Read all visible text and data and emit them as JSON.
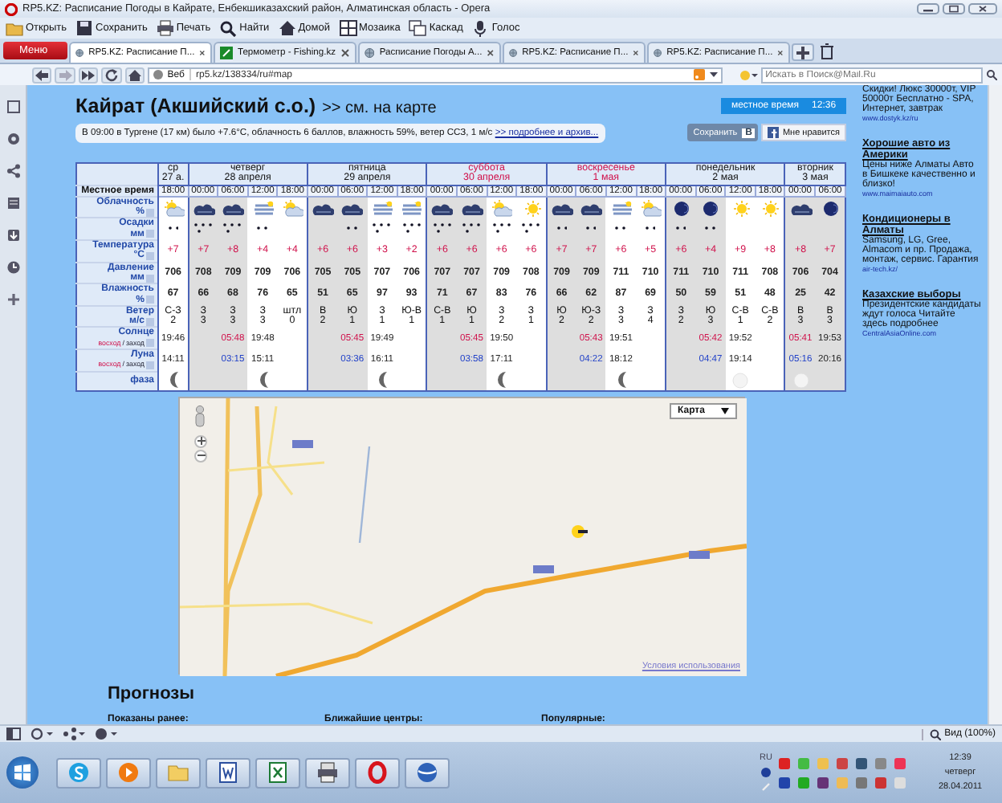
{
  "window": {
    "title": "RP5.KZ: Расписание Погоды в Кайрате, Енбекшиказахский район, Алматинская область - Opera"
  },
  "toolbar": [
    {
      "label": "Открыть"
    },
    {
      "label": "Сохранить"
    },
    {
      "label": "Печать"
    },
    {
      "label": "Найти"
    },
    {
      "label": "Домой"
    },
    {
      "label": "Мозаика"
    },
    {
      "label": "Каскад"
    },
    {
      "label": "Голос"
    }
  ],
  "menu_button": "Меню",
  "tabs": [
    {
      "label": "RP5.KZ: Расписание П...",
      "selected": true
    },
    {
      "label": "Термометр - Fishing.kz",
      "selected": false
    },
    {
      "label": "Расписание Погоды А...",
      "selected": false
    },
    {
      "label": "RP5.KZ: Расписание П...",
      "selected": false
    },
    {
      "label": "RP5.KZ: Расписание П...",
      "selected": false
    }
  ],
  "address_bar": {
    "search_engine": "Веб",
    "url": "rp5.kz/138334/ru#map",
    "search_placeholder": "Искать в Поиск@Mail.Ru"
  },
  "page": {
    "title": "Кайрат (Акшийский с.о.)",
    "map_link": ">> см. на карте",
    "local_time_label": "местное время",
    "local_time": "12:36",
    "observation": "В 09:00 в Тургене (17 км) было +7.6°C, облачность 6 баллов, влажность 59%, ветер ССЗ, 1 м/с",
    "observation_link": ">> подробнее и архив...",
    "save_button": "Сохранить",
    "save_badge": "В",
    "like_button": "Мне нравится"
  },
  "forecast": {
    "time_label": "Местное время",
    "row_labels": [
      {
        "name": "Облачность",
        "unit": "%"
      },
      {
        "name": "Осадки",
        "unit": "мм"
      },
      {
        "name": "Температура",
        "unit": "°C"
      },
      {
        "name": "Давление",
        "unit": "мм"
      },
      {
        "name": "Влажность",
        "unit": "%"
      },
      {
        "name": "Ветер",
        "unit": "м/с"
      }
    ],
    "sun_label": {
      "name": "Солнце",
      "rise": "восход",
      "sep": "/",
      "set": "заход"
    },
    "moon_label": {
      "name": "Луна",
      "rise": "восход",
      "sep": "/",
      "set": "заход",
      "phase": "фаза"
    },
    "days": [
      {
        "weekday": "ср",
        "date": "27 а.",
        "weekend": false,
        "sun": {
          "set": "19:46"
        },
        "moon": {
          "set": "14:11"
        },
        "phase": {
          "kind": "crescent"
        },
        "columns": [
          {
            "time": "18:00",
            "night": false,
            "sky": {
              "kind": "sun-cloud"
            },
            "precip": {
              "kind": "light"
            },
            "temp": "+7",
            "pressure": "706",
            "humidity": "67",
            "wind_dir": "С-З",
            "wind_speed": "2"
          }
        ]
      },
      {
        "weekday": "четверг",
        "date": "28 апреля",
        "weekend": false,
        "sun": {
          "rise": "05:48",
          "set": "19:48"
        },
        "moon": {
          "rise": "03:15",
          "set": "15:11"
        },
        "phase": {
          "kind": "crescent"
        },
        "columns": [
          {
            "time": "00:00",
            "night": true,
            "sky": {
              "kind": "dark"
            },
            "precip": {
              "kind": "medium"
            },
            "temp": "+7",
            "pressure": "708",
            "humidity": "66",
            "wind_dir": "З",
            "wind_speed": "3"
          },
          {
            "time": "06:00",
            "night": true,
            "sky": {
              "kind": "dark"
            },
            "precip": {
              "kind": "medium"
            },
            "temp": "+8",
            "pressure": "709",
            "humidity": "68",
            "wind_dir": "З",
            "wind_speed": "3"
          },
          {
            "time": "12:00",
            "night": false,
            "sky": {
              "kind": "stratus"
            },
            "precip": {
              "kind": "light"
            },
            "temp": "+4",
            "pressure": "709",
            "humidity": "76",
            "wind_dir": "З",
            "wind_speed": "3"
          },
          {
            "time": "18:00",
            "night": false,
            "sky": {
              "kind": "sun-cloud"
            },
            "precip": {
              "kind": "none"
            },
            "temp": "+4",
            "pressure": "706",
            "humidity": "65",
            "wind_dir": "штл",
            "wind_speed": "0"
          }
        ]
      },
      {
        "weekday": "пятница",
        "date": "29 апреля",
        "weekend": false,
        "sun": {
          "rise": "05:45",
          "set": "19:49"
        },
        "moon": {
          "rise": "03:36",
          "set": "16:11"
        },
        "phase": {
          "kind": "crescent"
        },
        "columns": [
          {
            "time": "00:00",
            "night": true,
            "sky": {
              "kind": "dark"
            },
            "precip": {
              "kind": "none"
            },
            "temp": "+6",
            "pressure": "705",
            "humidity": "51",
            "wind_dir": "В",
            "wind_speed": "2"
          },
          {
            "time": "06:00",
            "night": true,
            "sky": {
              "kind": "dark"
            },
            "precip": {
              "kind": "light"
            },
            "temp": "+6",
            "pressure": "705",
            "humidity": "65",
            "wind_dir": "Ю",
            "wind_speed": "1"
          },
          {
            "time": "12:00",
            "night": false,
            "sky": {
              "kind": "stratus"
            },
            "precip": {
              "kind": "medium"
            },
            "temp": "+3",
            "pressure": "707",
            "humidity": "97",
            "wind_dir": "З",
            "wind_speed": "1"
          },
          {
            "time": "18:00",
            "night": false,
            "sky": {
              "kind": "stratus"
            },
            "precip": {
              "kind": "medium"
            },
            "temp": "+2",
            "pressure": "706",
            "humidity": "93",
            "wind_dir": "Ю-В",
            "wind_speed": "1"
          }
        ]
      },
      {
        "weekday": "суббота",
        "date": "30 апреля",
        "weekend": true,
        "sun": {
          "rise": "05:45",
          "set": "19:50"
        },
        "moon": {
          "rise": "03:58",
          "set": "17:11"
        },
        "phase": {
          "kind": "crescent"
        },
        "columns": [
          {
            "time": "00:00",
            "night": true,
            "sky": {
              "kind": "dark"
            },
            "precip": {
              "kind": "medium"
            },
            "temp": "+6",
            "pressure": "707",
            "humidity": "71",
            "wind_dir": "С-В",
            "wind_speed": "1"
          },
          {
            "time": "06:00",
            "night": true,
            "sky": {
              "kind": "dark"
            },
            "precip": {
              "kind": "medium"
            },
            "temp": "+6",
            "pressure": "707",
            "humidity": "67",
            "wind_dir": "Ю",
            "wind_speed": "1"
          },
          {
            "time": "12:00",
            "night": false,
            "sky": {
              "kind": "sun-cloud"
            },
            "precip": {
              "kind": "medium"
            },
            "temp": "+6",
            "pressure": "709",
            "humidity": "83",
            "wind_dir": "З",
            "wind_speed": "2"
          },
          {
            "time": "18:00",
            "night": false,
            "sky": {
              "kind": "sun"
            },
            "precip": {
              "kind": "medium"
            },
            "temp": "+6",
            "pressure": "708",
            "humidity": "76",
            "wind_dir": "З",
            "wind_speed": "1"
          }
        ]
      },
      {
        "weekday": "воскресенье",
        "date": "1 мая",
        "weekend": true,
        "sun": {
          "rise": "05:43",
          "set": "19:51"
        },
        "moon": {
          "rise": "04:22",
          "set": "18:12"
        },
        "phase": {
          "kind": "crescent"
        },
        "columns": [
          {
            "time": "00:00",
            "night": true,
            "sky": {
              "kind": "dark"
            },
            "precip": {
              "kind": "light"
            },
            "temp": "+7",
            "pressure": "709",
            "humidity": "66",
            "wind_dir": "Ю",
            "wind_speed": "2"
          },
          {
            "time": "06:00",
            "night": true,
            "sky": {
              "kind": "dark"
            },
            "precip": {
              "kind": "light"
            },
            "temp": "+7",
            "pressure": "709",
            "humidity": "62",
            "wind_dir": "Ю-З",
            "wind_speed": "2"
          },
          {
            "time": "12:00",
            "night": false,
            "sky": {
              "kind": "stratus"
            },
            "precip": {
              "kind": "light"
            },
            "temp": "+6",
            "pressure": "711",
            "humidity": "87",
            "wind_dir": "З",
            "wind_speed": "3"
          },
          {
            "time": "18:00",
            "night": false,
            "sky": {
              "kind": "sun-cloud"
            },
            "precip": {
              "kind": "light"
            },
            "temp": "+5",
            "pressure": "710",
            "humidity": "69",
            "wind_dir": "З",
            "wind_speed": "4"
          }
        ]
      },
      {
        "weekday": "понедельник",
        "date": "2 мая",
        "weekend": false,
        "sun": {
          "rise": "05:42",
          "set": "19:52"
        },
        "moon": {
          "rise": "04:47",
          "set": "19:14"
        },
        "phase": {
          "kind": "new"
        },
        "columns": [
          {
            "time": "00:00",
            "night": true,
            "sky": {
              "kind": "moon"
            },
            "precip": {
              "kind": "light"
            },
            "temp": "+6",
            "pressure": "711",
            "humidity": "50",
            "wind_dir": "З",
            "wind_speed": "2"
          },
          {
            "time": "06:00",
            "night": true,
            "sky": {
              "kind": "moon"
            },
            "precip": {
              "kind": "light"
            },
            "temp": "+4",
            "pressure": "710",
            "humidity": "59",
            "wind_dir": "Ю",
            "wind_speed": "3"
          },
          {
            "time": "12:00",
            "night": false,
            "sky": {
              "kind": "sun"
            },
            "precip": {
              "kind": "none"
            },
            "temp": "+9",
            "pressure": "711",
            "humidity": "51",
            "wind_dir": "С-В",
            "wind_speed": "1"
          },
          {
            "time": "18:00",
            "night": false,
            "sky": {
              "kind": "sun"
            },
            "precip": {
              "kind": "none"
            },
            "temp": "+8",
            "pressure": "708",
            "humidity": "48",
            "wind_dir": "С-В",
            "wind_speed": "2"
          }
        ]
      },
      {
        "weekday": "вторник",
        "date": "3 мая",
        "weekend": false,
        "sun": {
          "rise": "05:41",
          "set": "19:53"
        },
        "moon": {
          "rise": "05:16",
          "set": "20:16"
        },
        "phase": {
          "kind": "new"
        },
        "columns": [
          {
            "time": "00:00",
            "night": true,
            "sky": {
              "kind": "dark"
            },
            "precip": {
              "kind": "none"
            },
            "temp": "+8",
            "pressure": "706",
            "humidity": "25",
            "wind_dir": "В",
            "wind_speed": "3"
          },
          {
            "time": "06:00",
            "night": true,
            "sky": {
              "kind": "moon"
            },
            "precip": {
              "kind": "none"
            },
            "temp": "+7",
            "pressure": "704",
            "humidity": "42",
            "wind_dir": "В",
            "wind_speed": "3"
          }
        ]
      }
    ]
  },
  "map": {
    "type_select": "Карта",
    "terms_link": "Условия использования"
  },
  "forecasts": {
    "title": "Прогнозы",
    "columns": [
      "Показаны ранее:",
      "Ближайшие центры:",
      "Популярные:"
    ]
  },
  "ads": [
    {
      "title": "Скидки! Люкс 30000т, VIP 50000т Бесплатно - SPA, Интернет, завтрак",
      "title_link": false,
      "url": "www.dostyk.kz/ru"
    },
    {
      "title": "Хорошие авто из Америки",
      "title_link": true,
      "text": "Цены ниже Алматы Авто в Бишкеке качественно и близко!",
      "url": "www.maimaiauto.com"
    },
    {
      "title": "Кондиционеры в Алматы",
      "title_link": true,
      "text": "Samsung, LG, Gree, Almacom и пр. Продажа, монтаж, сервис. Гарантия",
      "url": "air-tech.kz/"
    },
    {
      "title": "Казахские выборы",
      "title_link": true,
      "text": "Президентские кандидаты ждут голоса Читайте здесь подробнее",
      "url": "CentralAsiaOnline.com"
    }
  ],
  "status_bar": {
    "zoom": "Вид (100%)"
  },
  "taskbar": {
    "apps": [
      {
        "kind": "skype"
      },
      {
        "kind": "media"
      },
      {
        "kind": "explorer"
      },
      {
        "kind": "word"
      },
      {
        "kind": "excel"
      },
      {
        "kind": "printer"
      },
      {
        "kind": "opera"
      },
      {
        "kind": "earth"
      }
    ],
    "language": "RU",
    "time": "12:39",
    "weekday": "четверг",
    "date": "28.04.2011"
  }
}
